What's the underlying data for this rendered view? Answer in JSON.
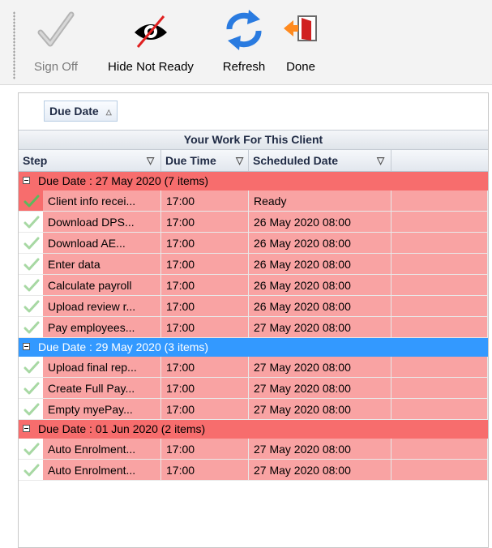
{
  "toolbar": {
    "sign_off": {
      "label": "Sign Off",
      "icon": "checkmark-icon",
      "enabled": false
    },
    "hide_not_ready": {
      "label": "Hide Not Ready",
      "icon": "eye-crossed-icon"
    },
    "refresh": {
      "label": "Refresh",
      "icon": "refresh-icon"
    },
    "done": {
      "label": "Done",
      "icon": "exit-door-icon"
    }
  },
  "group_panel": {
    "chip_label": "Due Date",
    "sort": "ascending"
  },
  "band_title": "Your Work For This Client",
  "columns": [
    "Step",
    "Due Time",
    "Scheduled Date"
  ],
  "colors": {
    "red_group": "#f76d6d",
    "blue_group": "#3399ff",
    "row_red": "#f9a3a3",
    "check_green": "#5cb85c"
  },
  "groups": [
    {
      "label": "Due Date : 27 May 2020 (7 items)",
      "color": "red",
      "rows": [
        {
          "step": "Client info recei...",
          "due_time": "17:00",
          "scheduled": "Ready",
          "check": "strong"
        },
        {
          "step": "Download  DPS...",
          "due_time": "17:00",
          "scheduled": "26 May 2020 08:00",
          "check": "light"
        },
        {
          "step": "Download  AE...",
          "due_time": "17:00",
          "scheduled": "26 May 2020 08:00",
          "check": "light"
        },
        {
          "step": "Enter data",
          "due_time": "17:00",
          "scheduled": "26 May 2020 08:00",
          "check": "light"
        },
        {
          "step": "Calculate payroll",
          "due_time": "17:00",
          "scheduled": "26 May 2020 08:00",
          "check": "light"
        },
        {
          "step": "Upload review r...",
          "due_time": "17:00",
          "scheduled": "26 May 2020 08:00",
          "check": "light"
        },
        {
          "step": "Pay  employees...",
          "due_time": "17:00",
          "scheduled": "27 May 2020 08:00",
          "check": "light"
        }
      ]
    },
    {
      "label": "Due Date : 29 May 2020 (3 items)",
      "color": "blue",
      "rows": [
        {
          "step": "Upload final rep...",
          "due_time": "17:00",
          "scheduled": "27 May 2020 08:00",
          "check": "light"
        },
        {
          "step": "Create Full Pay...",
          "due_time": "17:00",
          "scheduled": "27 May 2020 08:00",
          "check": "light"
        },
        {
          "step": "Empty  myePay...",
          "due_time": "17:00",
          "scheduled": "27 May 2020 08:00",
          "check": "light"
        }
      ]
    },
    {
      "label": "Due Date : 01 Jun 2020 (2 items)",
      "color": "red",
      "rows": [
        {
          "step": "Auto  Enrolment...",
          "due_time": "17:00",
          "scheduled": "27 May 2020 08:00",
          "check": "light"
        },
        {
          "step": "Auto  Enrolment...",
          "due_time": "17:00",
          "scheduled": "27 May 2020 08:00",
          "check": "light"
        }
      ]
    }
  ]
}
